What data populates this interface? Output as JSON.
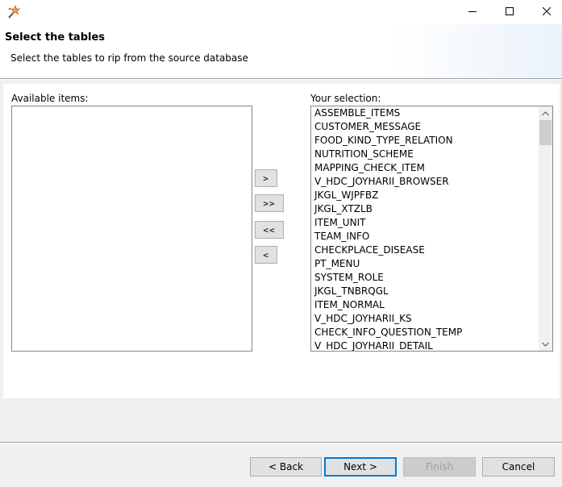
{
  "window": {
    "icon": "wand-icon",
    "controls": {
      "minimize": "minimize-icon",
      "maximize": "maximize-icon",
      "close": "close-icon"
    }
  },
  "header": {
    "title": "Select the tables",
    "description": "Select the tables to rip from the source database"
  },
  "available": {
    "label": "Available items:",
    "items": []
  },
  "selection": {
    "label": "Your selection:",
    "items": [
      "ASSEMBLE_ITEMS",
      "CUSTOMER_MESSAGE",
      "FOOD_KIND_TYPE_RELATION",
      "NUTRITION_SCHEME",
      "MAPPING_CHECK_ITEM",
      "V_HDC_JOYHARII_BROWSER",
      "JKGL_WJPFBZ",
      "JKGL_XTZLB",
      "ITEM_UNIT",
      "TEAM_INFO",
      "CHECKPLACE_DISEASE",
      "PT_MENU",
      "SYSTEM_ROLE",
      "JKGL_TNBRQGL",
      "ITEM_NORMAL",
      "V_HDC_JOYHARII_KS",
      "CHECK_INFO_QUESTION_TEMP",
      "V_HDC_JOYHARII_DETAIL"
    ]
  },
  "move_buttons": {
    "add": ">",
    "add_all": ">>",
    "remove_all": "<<",
    "remove": "<"
  },
  "footer": {
    "back": "< Back",
    "next": "Next >",
    "finish": "Finish",
    "cancel": "Cancel"
  },
  "colors": {
    "accent": "#0078d7",
    "list_border": "#828790",
    "disabled_text": "#a0a0a0"
  }
}
